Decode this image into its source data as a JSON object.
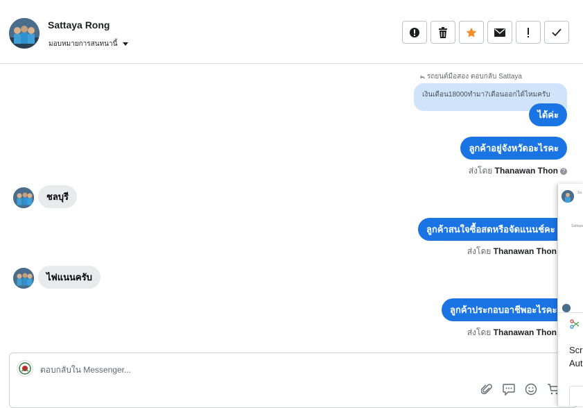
{
  "header": {
    "contact_name": "Sattaya Rong",
    "assign_label": "มอบหมายการสนทนานี้",
    "toolbar": [
      {
        "name": "spam-button",
        "icon": "alert-circle-icon"
      },
      {
        "name": "delete-button",
        "icon": "trash-icon"
      },
      {
        "name": "star-button",
        "icon": "star-icon"
      },
      {
        "name": "mark-unread-button",
        "icon": "envelope-icon"
      },
      {
        "name": "follow-up-button",
        "icon": "exclamation-icon"
      },
      {
        "name": "mark-done-button",
        "icon": "check-icon"
      }
    ]
  },
  "thread": {
    "reply_meta": "รถยนต์มือสอง ตอบกลับ Sattaya",
    "quoted_text": "เงินเดือน18000ทำมา7เดือนออกได้ไหมครับ",
    "msg1": "ได้ค่ะ",
    "msg2": "ลูกค้าอยู่จังหวัดอะไรคะ",
    "sent_by_label": "ส่งโดย",
    "agent_name": "Thanawan Thon",
    "in1": "ชลบุรี",
    "msg3": "ลูกค้าสนใจซื้อสดหรือจัดแนนช์คะ",
    "in2": "ไฟแนนครับ",
    "msg4": "ลูกค้าประกอบอาชีพอะไรคะ"
  },
  "composer": {
    "placeholder": "ตอบกลับใน Messenger..."
  },
  "side_panel": {
    "snippet_1": "Scre",
    "snippet_2": "Aut",
    "tiny_1": "Sa",
    "tiny_2": "Sattaya"
  },
  "colors": {
    "accent": "#1b74e4",
    "star": "#f28c28",
    "quoted_bg": "#cfe3fb"
  }
}
